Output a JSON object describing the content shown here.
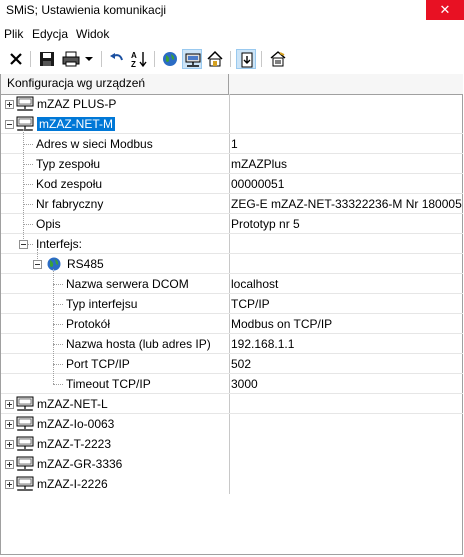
{
  "window": {
    "title": "SMiS; Ustawienia komunikacji",
    "close": "✕"
  },
  "menu": [
    "Plik",
    "Edycja",
    "Widok"
  ],
  "toolbar": [
    {
      "icon": "delete-icon",
      "pressed": false
    },
    {
      "icon": "save-icon",
      "pressed": false
    },
    {
      "icon": "print-icon",
      "pressed": false
    },
    {
      "icon": "dropdown-arrow-icon",
      "pressed": false
    },
    {
      "icon": "undo-icon",
      "pressed": false
    },
    {
      "icon": "sort-az-icon",
      "pressed": false
    },
    {
      "icon": "globe-icon",
      "pressed": false
    },
    {
      "icon": "network-device-icon",
      "pressed": true
    },
    {
      "icon": "home-icon",
      "pressed": false
    },
    {
      "icon": "properties-icon",
      "pressed": true
    },
    {
      "icon": "edit-device-icon",
      "pressed": false
    }
  ],
  "tree": {
    "columns": [
      "Konfiguracja wg urządzeń",
      ""
    ],
    "rows": [
      {
        "name": "mZAZ PLUS-P",
        "value": "",
        "type": "device",
        "expanded": false
      },
      {
        "name": "mZAZ-NET-M",
        "value": "",
        "type": "device",
        "expanded": true,
        "selected": true
      },
      {
        "name": "Adres w sieci Modbus",
        "value": "1",
        "type": "prop"
      },
      {
        "name": "Typ zespołu",
        "value": "mZAZPlus",
        "type": "prop"
      },
      {
        "name": "Kod zespołu",
        "value": "00000051",
        "type": "prop"
      },
      {
        "name": "Nr fabryczny",
        "value": "ZEG-E  mZAZ-NET-33322236-M Nr 180005",
        "type": "prop"
      },
      {
        "name": "Opis",
        "value": "Prototyp nr 5",
        "type": "prop"
      },
      {
        "name": "Interfejs:",
        "value": "",
        "type": "group",
        "expanded": true
      },
      {
        "name": "RS485",
        "value": "",
        "type": "iface",
        "expanded": true
      },
      {
        "name": "Nazwa serwera DCOM",
        "value": "localhost",
        "type": "subprop"
      },
      {
        "name": "Typ interfejsu",
        "value": "TCP/IP",
        "type": "subprop"
      },
      {
        "name": "Protokół",
        "value": "Modbus on TCP/IP",
        "type": "subprop"
      },
      {
        "name": "Nazwa hosta (lub adres IP)",
        "value": "192.168.1.1",
        "type": "subprop"
      },
      {
        "name": "Port TCP/IP",
        "value": "502",
        "type": "subprop"
      },
      {
        "name": "Timeout TCP/IP",
        "value": "3000",
        "type": "subprop"
      },
      {
        "name": "mZAZ-NET-L",
        "value": "",
        "type": "device",
        "expanded": false
      },
      {
        "name": "mZAZ-Io-0063",
        "value": "",
        "type": "device",
        "expanded": false
      },
      {
        "name": "mZAZ-T-2223",
        "value": "",
        "type": "device",
        "expanded": false
      },
      {
        "name": "mZAZ-GR-3336",
        "value": "",
        "type": "device",
        "expanded": false
      },
      {
        "name": "mZAZ-I-2226",
        "value": "",
        "type": "device",
        "expanded": false
      }
    ]
  },
  "colors": {
    "selection": "#0078d7",
    "close": "#e81123"
  }
}
